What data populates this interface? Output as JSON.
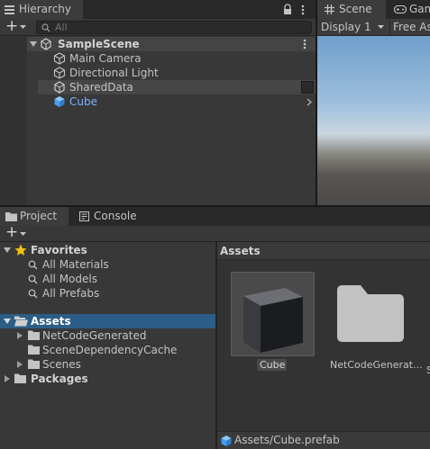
{
  "hierarchy": {
    "tab_label": "Hierarchy",
    "add_label": "+",
    "search_placeholder": "All",
    "scene_name": "SampleScene",
    "items": [
      {
        "label": "Main Camera"
      },
      {
        "label": "Directional Light"
      },
      {
        "label": "SharedData"
      },
      {
        "label": "Cube"
      }
    ]
  },
  "scene_view": {
    "tabs": [
      {
        "label": "Scene"
      },
      {
        "label": "Gam"
      }
    ],
    "display_label": "Display 1",
    "aspect_label": "Free As"
  },
  "project": {
    "tabs": [
      {
        "label": "Project"
      },
      {
        "label": "Console"
      }
    ],
    "add_label": "+",
    "tree": {
      "favorites_label": "Favorites",
      "favorites": [
        {
          "label": "All Materials"
        },
        {
          "label": "All Models"
        },
        {
          "label": "All Prefabs"
        }
      ],
      "assets_label": "Assets",
      "assets_children": [
        {
          "label": "NetCodeGenerated"
        },
        {
          "label": "SceneDependencyCache"
        },
        {
          "label": "Scenes"
        }
      ],
      "packages_label": "Packages"
    },
    "grid": {
      "header": "Assets",
      "items": [
        {
          "label": "Cube"
        },
        {
          "label": "NetCodeGenerat..."
        }
      ]
    },
    "status_path": "Assets/Cube.prefab"
  },
  "colors": {
    "selection": "#2c5d87",
    "accent_text": "#7cb3ff",
    "panel_bg": "#383838",
    "star": "#f4c112"
  }
}
